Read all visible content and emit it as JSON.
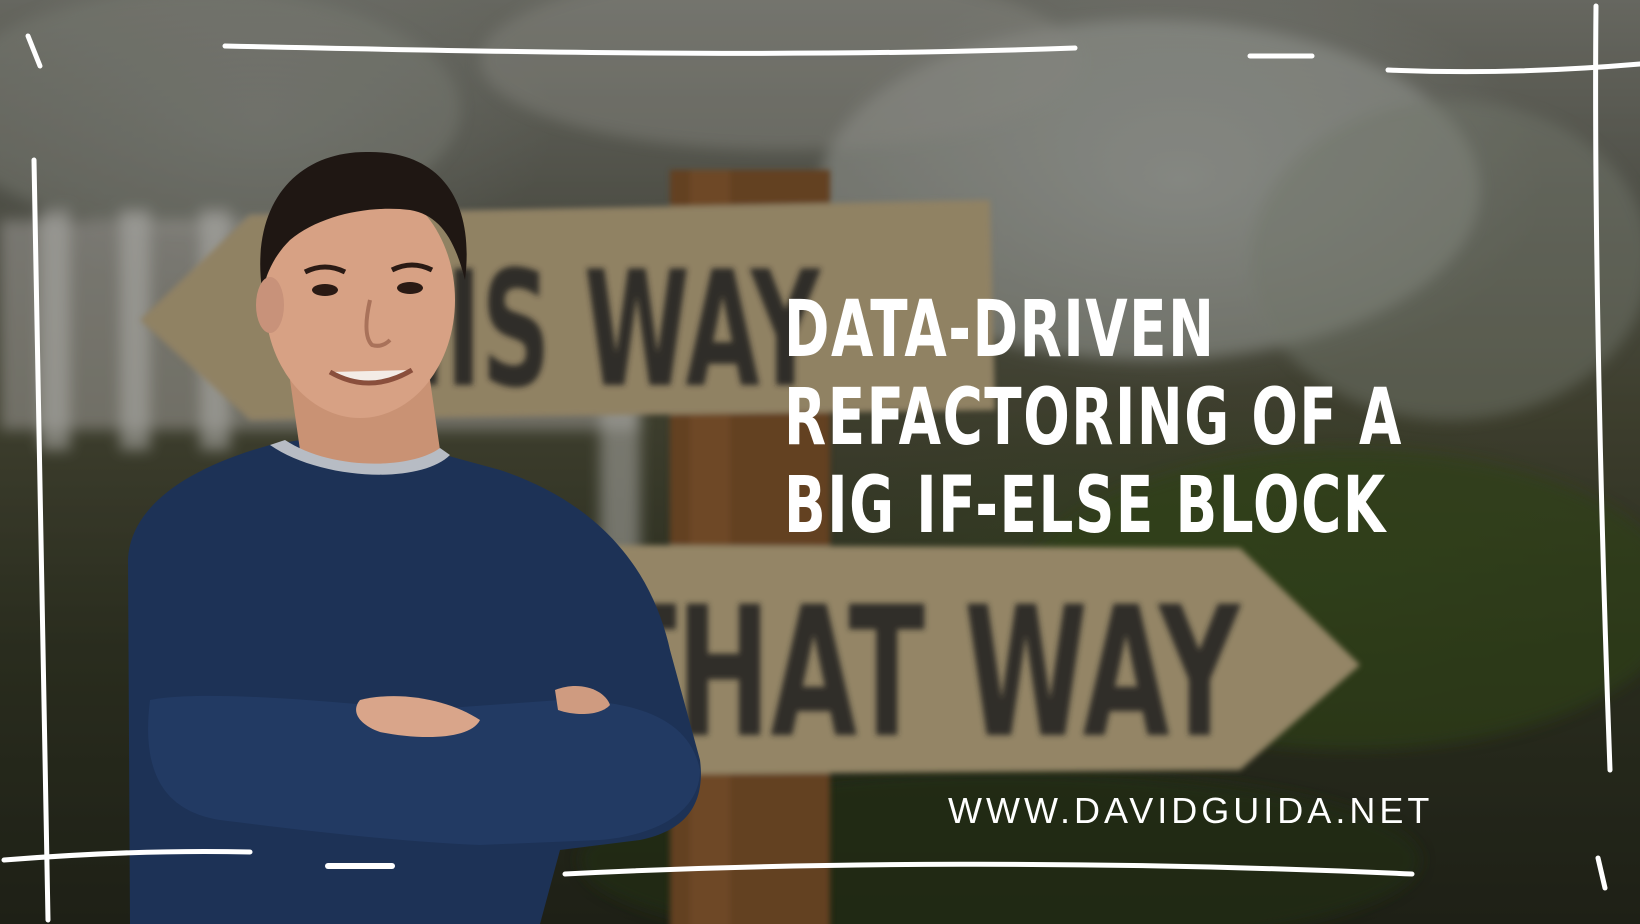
{
  "headline": {
    "line1": "DATA-DRIVEN",
    "line2": "REFACTORING OF A",
    "line3": "BIG IF-ELSE BLOCK"
  },
  "website": "WWW.DAVIDGUIDA.NET",
  "signs": {
    "top": "THIS WAY",
    "bottom": "THAT WAY"
  },
  "colors": {
    "text": "#ffffff",
    "sweater": "#1d3256",
    "sign": "#c8b48a"
  }
}
